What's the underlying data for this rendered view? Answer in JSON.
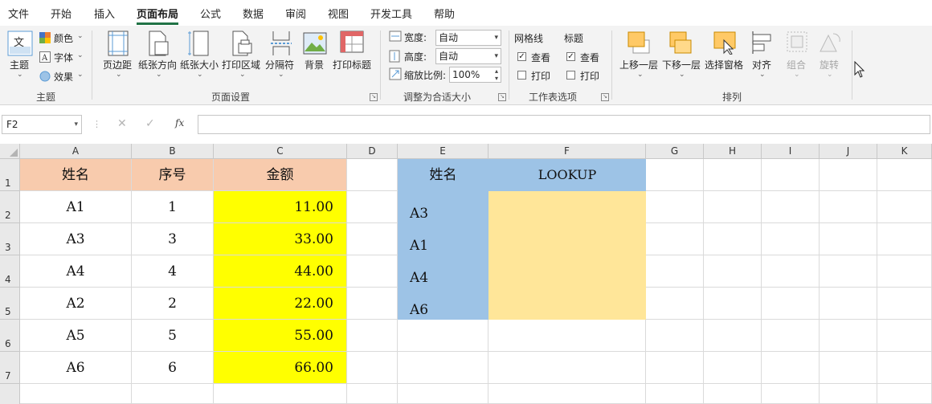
{
  "tabs": [
    "文件",
    "开始",
    "插入",
    "页面布局",
    "公式",
    "数据",
    "审阅",
    "视图",
    "开发工具",
    "帮助"
  ],
  "active_tab": "页面布局",
  "ribbon": {
    "themes": {
      "theme_label": "主题",
      "colors_label": "颜色",
      "fonts_label": "字体",
      "effects_label": "效果",
      "group_label": "主题",
      "theme_icon_text": "文"
    },
    "page_setup": {
      "margins": "页边距",
      "orientation": "纸张方向",
      "size": "纸张大小",
      "print_area": "打印区域",
      "breaks": "分隔符",
      "background": "背景",
      "print_titles": "打印标题",
      "group_label": "页面设置"
    },
    "scale_to_fit": {
      "width_label": "宽度:",
      "width_value": "自动",
      "height_label": "高度:",
      "height_value": "自动",
      "scale_label": "缩放比例:",
      "scale_value": "100%",
      "group_label": "调整为合适大小"
    },
    "sheet_options": {
      "gridlines_label": "网格线",
      "headings_label": "标题",
      "view_label": "查看",
      "print_label": "打印",
      "group_label": "工作表选项"
    },
    "arrange": {
      "bring_forward": "上移一层",
      "send_backward": "下移一层",
      "selection_pane": "选择窗格",
      "align": "对齐",
      "group": "组合",
      "rotate": "旋转",
      "group_label": "排列"
    }
  },
  "formula_bar": {
    "name_box": "F2",
    "formula": "",
    "fx": "fx"
  },
  "columns": [
    "A",
    "B",
    "C",
    "D",
    "E",
    "F",
    "G",
    "H",
    "I",
    "J",
    "K"
  ],
  "rows": [
    "1",
    "2",
    "3",
    "4",
    "5",
    "6",
    "7"
  ],
  "table1": {
    "headers": [
      "姓名",
      "序号",
      "金额"
    ],
    "rows": [
      [
        "A1",
        "1",
        "11.00"
      ],
      [
        "A3",
        "3",
        "33.00"
      ],
      [
        "A4",
        "4",
        "44.00"
      ],
      [
        "A2",
        "2",
        "22.00"
      ],
      [
        "A5",
        "5",
        "55.00"
      ],
      [
        "A6",
        "6",
        "66.00"
      ]
    ]
  },
  "table2": {
    "headers": [
      "姓名",
      "LOOKUP"
    ],
    "names": [
      "A3",
      "A1",
      "A4",
      "A6"
    ]
  },
  "colors": {
    "accent": "#217346",
    "peach": "#f8cbad",
    "blue": "#9dc3e6",
    "yellow": "#ffff00",
    "light_yellow": "#ffe699"
  }
}
